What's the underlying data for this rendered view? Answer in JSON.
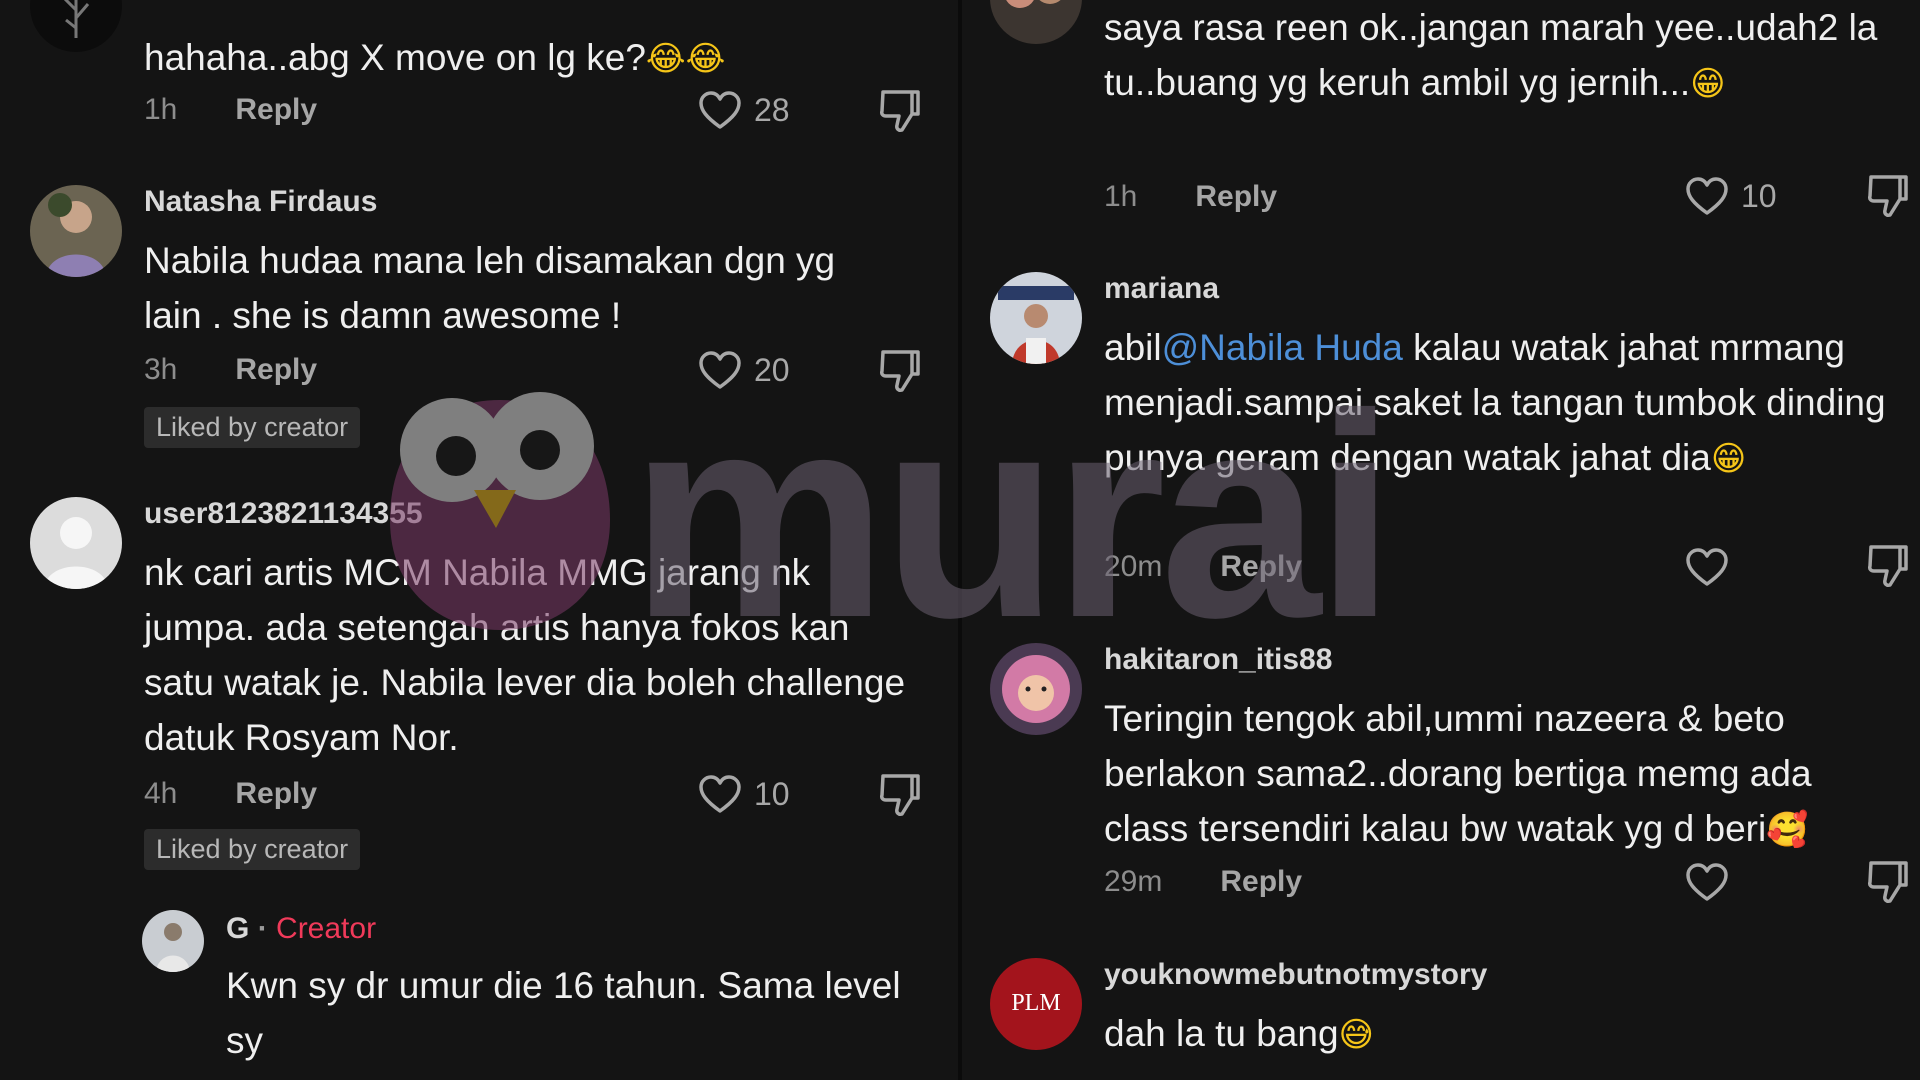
{
  "left": {
    "c0": {
      "text": "hahaha..abg X move on lg ke?",
      "emoji": "😂😂",
      "time": "1h",
      "reply": "Reply",
      "likes": "28"
    },
    "c1": {
      "username": "Natasha Firdaus",
      "text": "Nabila hudaa mana leh disamakan dgn yg lain . she is damn awesome !",
      "time": "3h",
      "reply": "Reply",
      "likes": "20",
      "badge": "Liked by creator"
    },
    "c2": {
      "username": "user8123821134355",
      "text": "nk cari artis MCM Nabila MMG jarang nk jumpa. ada setengah artis hanya fokos kan satu watak je. Nabila lever dia boleh challenge datuk Rosyam Nor.",
      "time": "4h",
      "reply": "Reply",
      "likes": "10",
      "badge": "Liked by creator"
    },
    "c3": {
      "username": "G",
      "dot": "·",
      "creator": "Creator",
      "text": "Kwn sy dr umur die 16 tahun. Sama level sy"
    }
  },
  "right": {
    "c0": {
      "text": "saya rasa reen ok..jangan marah yee..udah2 la tu..buang yg keruh ambil yg jernih...",
      "emoji": "😁",
      "time": "1h",
      "reply": "Reply",
      "likes": "10"
    },
    "c1": {
      "username": "mariana",
      "text_pre": "abil",
      "mention": "@Nabila Huda",
      "text_post": " kalau watak jahat mrmang menjadi.sampai saket la tangan tumbok dinding punya geram dengan watak jahat dia",
      "emoji": "😁",
      "time": "20m",
      "reply": "Reply"
    },
    "c2": {
      "username": "hakitaron_itis88",
      "text": "Teringin tengok abil,ummi nazeera & beto berlakon sama2..dorang bertiga memg ada class tersendiri kalau bw watak yg d beri",
      "emoji": "🥰",
      "time": "29m",
      "reply": "Reply"
    },
    "c3": {
      "username": "youknowmebutnotmystory",
      "avatar_text": "PLM",
      "text": "dah la tu bang",
      "emoji": "😅"
    }
  },
  "watermark": {
    "text": "murai"
  },
  "colors": {
    "background": "#141414",
    "mention": "#4d8fd8",
    "creator": "#f03a5a",
    "badge_bg": "#2c2c2c"
  }
}
